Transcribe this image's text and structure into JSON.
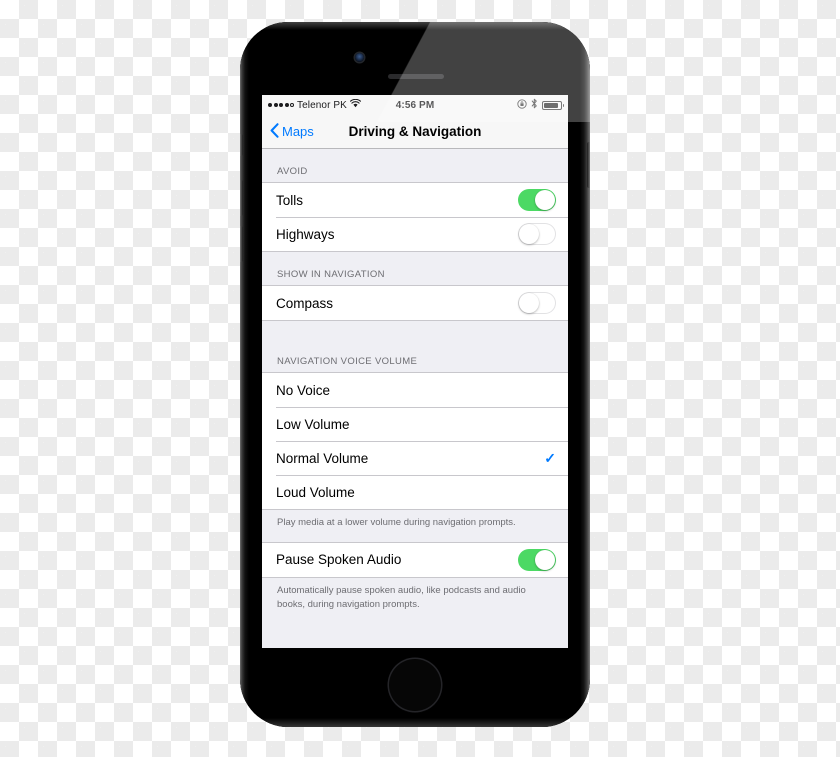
{
  "device": {
    "name": "iphone-6s",
    "camera": "front-camera",
    "speaker": "earpiece-speaker",
    "home_button": "home-button"
  },
  "status_bar": {
    "signal_dots_filled": 4,
    "signal_dots_total": 5,
    "carrier": "Telenor PK",
    "wifi_icon": "wifi-icon",
    "time": "4:56 PM",
    "rotation_lock_icon": "rotation-lock-icon",
    "bluetooth_icon": "bluetooth-icon",
    "battery_icon": "battery-icon",
    "battery_level": 88
  },
  "nav_bar": {
    "back_chevron_icon": "chevron-left-icon",
    "back_label": "Maps",
    "title": "Driving & Navigation",
    "accent_color": "#007aff"
  },
  "sections": [
    {
      "header": "AVOID",
      "rows": [
        {
          "label": "Tolls",
          "toggle": "on"
        },
        {
          "label": "Highways",
          "toggle": "off"
        }
      ]
    },
    {
      "header": "SHOW IN NAVIGATION",
      "rows": [
        {
          "label": "Compass",
          "toggle": "off"
        }
      ]
    },
    {
      "header": "NAVIGATION VOICE VOLUME",
      "rows": [
        {
          "label": "No Voice",
          "selected": false
        },
        {
          "label": "Low Volume",
          "selected": false
        },
        {
          "label": "Normal Volume",
          "selected": true
        },
        {
          "label": "Loud Volume",
          "selected": false
        }
      ],
      "footer": "Play media at a lower volume during navigation prompts."
    },
    {
      "header": "",
      "rows": [
        {
          "label": "Pause Spoken Audio",
          "toggle": "on"
        }
      ],
      "footer": "Automatically pause spoken audio, like podcasts and audio books, during navigation prompts."
    }
  ],
  "checkmark_glyph": "✓",
  "colors": {
    "toggle_on": "#4cd964",
    "accent": "#007aff",
    "group_background": "#ffffff",
    "page_background": "#efeff4",
    "header_text": "#6d6d72"
  }
}
